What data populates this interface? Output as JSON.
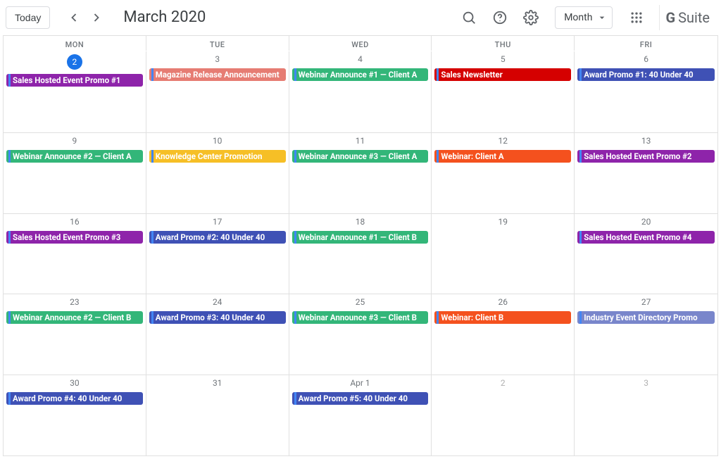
{
  "header": {
    "today_label": "Today",
    "month_title": "March 2020",
    "view_label": "Month",
    "gsuite_g": "G",
    "gsuite_suite": "Suite"
  },
  "colors": {
    "purple": "#8e24aa",
    "salmon": "#e67c73",
    "green": "#33b679",
    "red": "#d50000",
    "blue": "#3f51b5",
    "orange": "#f4511e",
    "yellow": "#f6bf26",
    "lightblue": "#7986cb",
    "ltblue2": "#4285f4"
  },
  "weekdays": [
    "MON",
    "TUE",
    "WED",
    "THU",
    "FRI"
  ],
  "weeks": [
    {
      "days": [
        {
          "label": "2",
          "today": true,
          "events": [
            {
              "text": "Sales Hosted Event Promo #1",
              "bg": "purple",
              "stripe": "ltblue2"
            }
          ]
        },
        {
          "label": "3",
          "events": [
            {
              "text": "Magazine Release Announcement",
              "bg": "salmon",
              "stripe": "ltblue2"
            }
          ]
        },
        {
          "label": "4",
          "events": [
            {
              "text": "Webinar Announce #1 — Client A",
              "bg": "green",
              "stripe": "ltblue2"
            }
          ]
        },
        {
          "label": "5",
          "events": [
            {
              "text": "Sales Newsletter",
              "bg": "red",
              "stripe": "ltblue2"
            }
          ]
        },
        {
          "label": "6",
          "events": [
            {
              "text": "Award Promo #1: 40 Under 40",
              "bg": "blue",
              "stripe": "ltblue2"
            }
          ]
        }
      ]
    },
    {
      "days": [
        {
          "label": "9",
          "events": [
            {
              "text": "Webinar Announce #2 — Client A",
              "bg": "green",
              "stripe": "ltblue2"
            }
          ]
        },
        {
          "label": "10",
          "events": [
            {
              "text": "Knowledge Center Promotion",
              "bg": "yellow",
              "stripe": "ltblue2"
            }
          ]
        },
        {
          "label": "11",
          "events": [
            {
              "text": "Webinar Announce #3 — Client A",
              "bg": "green",
              "stripe": "ltblue2"
            }
          ]
        },
        {
          "label": "12",
          "events": [
            {
              "text": "Webinar: Client A",
              "bg": "orange",
              "stripe": "ltblue2"
            }
          ]
        },
        {
          "label": "13",
          "events": [
            {
              "text": "Sales Hosted Event Promo #2",
              "bg": "purple",
              "stripe": "ltblue2"
            }
          ]
        }
      ]
    },
    {
      "days": [
        {
          "label": "16",
          "events": [
            {
              "text": "Sales Hosted Event Promo #3",
              "bg": "purple",
              "stripe": "ltblue2"
            }
          ]
        },
        {
          "label": "17",
          "events": [
            {
              "text": "Award Promo #2: 40 Under 40",
              "bg": "blue",
              "stripe": "ltblue2"
            }
          ]
        },
        {
          "label": "18",
          "events": [
            {
              "text": "Webinar Announce #1 — Client B",
              "bg": "green",
              "stripe": "ltblue2"
            }
          ]
        },
        {
          "label": "19",
          "events": []
        },
        {
          "label": "20",
          "events": [
            {
              "text": "Sales Hosted Event Promo #4",
              "bg": "purple",
              "stripe": "ltblue2"
            }
          ]
        }
      ]
    },
    {
      "days": [
        {
          "label": "23",
          "events": [
            {
              "text": "Webinar Announce #2 — Client B",
              "bg": "green",
              "stripe": "ltblue2"
            }
          ]
        },
        {
          "label": "24",
          "events": [
            {
              "text": "Award Promo #3: 40 Under 40",
              "bg": "blue",
              "stripe": "ltblue2"
            }
          ]
        },
        {
          "label": "25",
          "events": [
            {
              "text": "Webinar Announce #3 — Client B",
              "bg": "green",
              "stripe": "ltblue2"
            }
          ]
        },
        {
          "label": "26",
          "events": [
            {
              "text": "Webinar: Client B",
              "bg": "orange",
              "stripe": "ltblue2"
            }
          ]
        },
        {
          "label": "27",
          "events": [
            {
              "text": "Industry Event Directory Promo",
              "bg": "lightblue",
              "stripe": "ltblue2"
            }
          ]
        }
      ]
    },
    {
      "days": [
        {
          "label": "30",
          "events": [
            {
              "text": "Award Promo #4: 40 Under 40",
              "bg": "blue",
              "stripe": "ltblue2"
            }
          ]
        },
        {
          "label": "31",
          "events": []
        },
        {
          "label": "Apr 1",
          "events": [
            {
              "text": "Award Promo #5: 40 Under 40",
              "bg": "blue",
              "stripe": "ltblue2"
            }
          ]
        },
        {
          "label": "2",
          "other": true,
          "events": []
        },
        {
          "label": "3",
          "other": true,
          "events": []
        }
      ]
    }
  ]
}
